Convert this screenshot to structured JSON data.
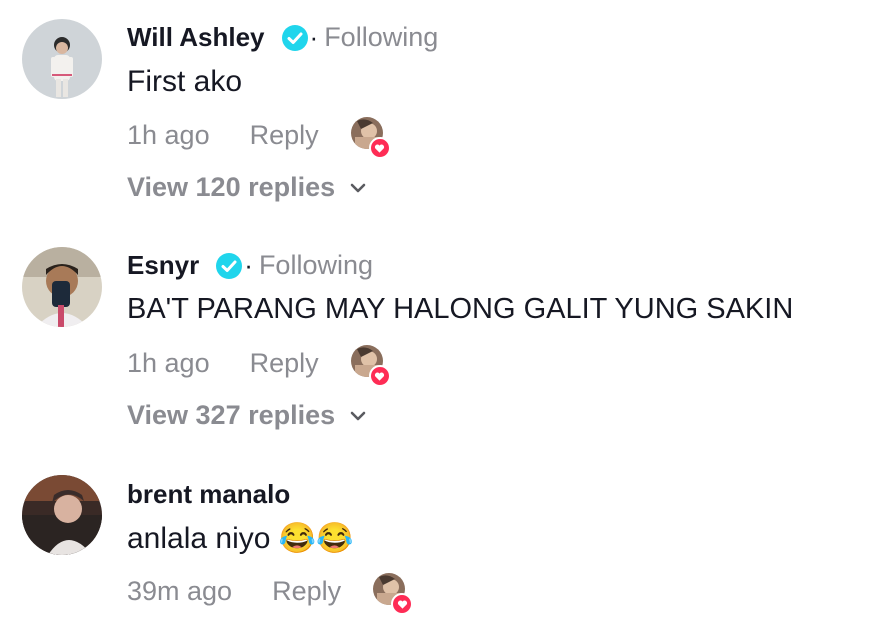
{
  "comments": [
    {
      "username": "Will Ashley",
      "verified": true,
      "following_label": "Following",
      "text": "First ako",
      "time": "1h ago",
      "reply_label": "Reply",
      "view_replies": "View 120 replies"
    },
    {
      "username": "Esnyr",
      "verified": true,
      "following_label": "Following",
      "text": "BA'T PARANG MAY HALONG GALIT YUNG SAKIN",
      "time": "1h ago",
      "reply_label": "Reply",
      "view_replies": "View 327 replies"
    },
    {
      "username": "brent manalo",
      "verified": false,
      "text": "anlala niyo 😂😂",
      "time": "39m ago",
      "reply_label": "Reply"
    }
  ],
  "icons": {
    "verified": "verified-check-icon",
    "chevron": "chevron-down-icon",
    "liked_by_creator": "creator-heart-icon"
  },
  "colors": {
    "text": "#161823",
    "secondary": "#8a8b91",
    "verified": "#20d5ec",
    "heart": "#fe2c55"
  }
}
